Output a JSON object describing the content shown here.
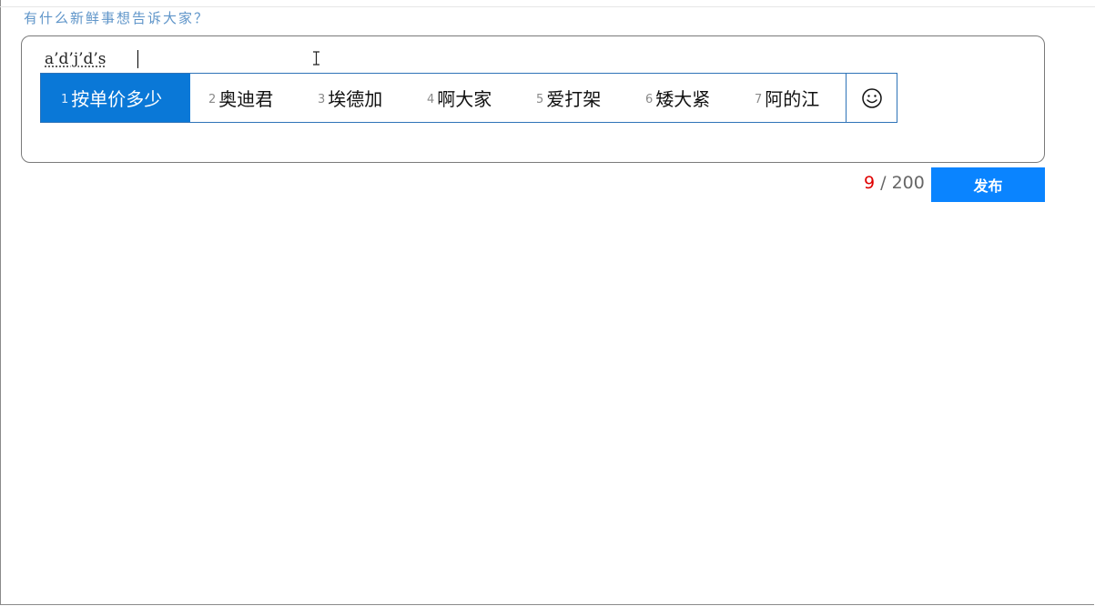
{
  "composer": {
    "prompt": "有什么新鲜事想告诉大家？",
    "composition_text": "a’d’j’d’s",
    "counter": {
      "current": "9",
      "separator": " / ",
      "max": "200"
    },
    "publish_label": "发布"
  },
  "ime": {
    "candidates": [
      {
        "num": "1",
        "word": "按单价多少",
        "selected": true
      },
      {
        "num": "2",
        "word": "奥迪君"
      },
      {
        "num": "3",
        "word": "埃德加"
      },
      {
        "num": "4",
        "word": "啊大家"
      },
      {
        "num": "5",
        "word": "爱打架"
      },
      {
        "num": "6",
        "word": "矮大紧"
      },
      {
        "num": "7",
        "word": "阿的江"
      }
    ],
    "emoji_icon": "smiley-face-icon"
  },
  "colors": {
    "accent": "#0a78d7",
    "publish": "#0a84ff",
    "prompt": "#5f95c9",
    "count_current": "#e00000"
  }
}
